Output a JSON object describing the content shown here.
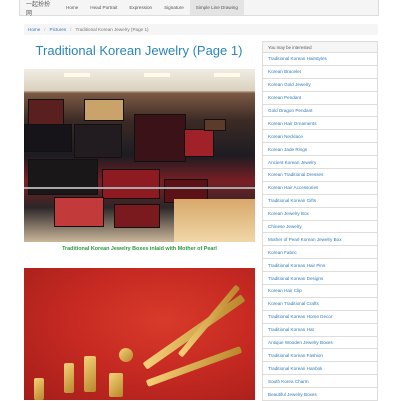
{
  "navbar": {
    "brand": "一起扮扮网",
    "items": [
      "Home",
      "Head Portrait",
      "Expression",
      "Signature",
      "Simple Line Drawing"
    ]
  },
  "breadcrumb": {
    "home": "Home",
    "section": "Pictures",
    "current": "Traditional Korean Jewelry (Page 1)"
  },
  "main": {
    "title": "Traditional Korean Jewelry (Page 1)",
    "caption1": "Traditional Korean Jewelry Boxes inlaid with Mother of Pearl"
  },
  "sidebar": {
    "heading": "You may be interested",
    "items": [
      "Traditional Korean Hairstyles",
      "Korean Bracelet",
      "Korean Gold Jewelry",
      "Korean Pendant",
      "Gold Dragon Pendant",
      "Korean Hair Ornaments",
      "Korean Necklace",
      "Korean Jade Rings",
      "Ancient Korean Jewelry",
      "Korean Traditional Dresses",
      "Korean Hair Accessories",
      "Traditional Korean Gifts",
      "Korean Jewelry Box",
      "Chinese Jewelry",
      "Mother of Pearl Korean Jewelry Box",
      "Korean Fabric",
      "Traditional Korean Hair Pins",
      "Traditional Korean Designs",
      "Korean Hair Clip",
      "Korean Traditional Crafts",
      "Traditional Korean Home Decor",
      "Traditional Korean Hat",
      "Antique Wooden Jewelry Boxes",
      "Traditional Korean Fashion",
      "Traditional Korean Hanbok",
      "South Korea Charm",
      "Beautiful Jewelry Boxes"
    ]
  }
}
